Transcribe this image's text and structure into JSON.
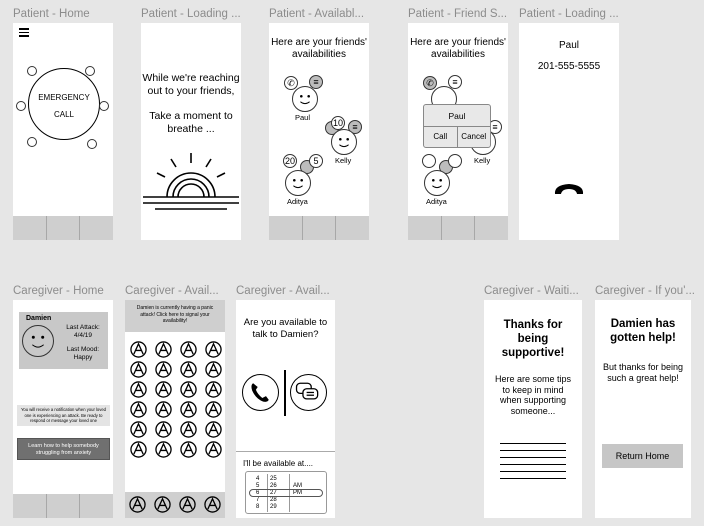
{
  "frames": {
    "f1": "Patient - Home",
    "f2": "Patient - Loading ...",
    "f3": "Patient - Availabl...",
    "f4": "Patient - Friend S...",
    "f5": "Patient - Loading ...",
    "f6": "Caregiver - Home",
    "f7": "Caregiver - Avail...",
    "f8": "Caregiver - Avail...",
    "f9": "Caregiver - Waiti...",
    "f10": "Caregiver - If you'..."
  },
  "patient_home": {
    "emergency_line1": "EMERGENCY",
    "emergency_line2": "CALL"
  },
  "patient_loading": {
    "line1": "While we're reaching",
    "line2": "out to your friends,",
    "line3": "Take a moment to",
    "line4": "breathe ..."
  },
  "availability": {
    "heading_line1": "Here are your friends'",
    "heading_line2": "availabilities",
    "friends": [
      "Paul",
      "Kelly",
      "Aditya"
    ],
    "badges": {
      "kelly": "10",
      "aditya_time": "20",
      "aditya_small": "5",
      "kelly_small": "5"
    }
  },
  "friend_select": {
    "heading_line1": "Here are your friends'",
    "heading_line2": "availabilities",
    "popup_name": "Paul",
    "call_button": "Call",
    "cancel_button": "Cancel",
    "friends": [
      "Kelly",
      "Aditya"
    ]
  },
  "calling": {
    "name": "Paul",
    "phone": "201-555-5555"
  },
  "caregiver_home": {
    "patient_name": "Damien",
    "last_attack_label": "Last Attack:",
    "last_attack_date": "4/4/19",
    "last_mood_label": "Last Mood:",
    "last_mood_value": "Happy",
    "notice": "You will receive a notification when your loved one is experiencing an attack. Be ready to respond or message your loved one",
    "help_button_line1": "Learn how to help somebody",
    "help_button_line2": "struggling from anxiety"
  },
  "caregiver_alert": {
    "banner": "Damien is currently having a panic attack! Click here to signal your availability!"
  },
  "caregiver_respond": {
    "question_line1": "Are you available to",
    "question_line2": "talk to Damien?",
    "later_label": "I'll be available at....",
    "hours": [
      "4",
      "5",
      "6",
      "7",
      "8"
    ],
    "minutes": [
      "25",
      "26",
      "27",
      "28",
      "29"
    ],
    "ampm": [
      "AM",
      "PM"
    ]
  },
  "caregiver_waiting": {
    "title_line1": "Thanks for",
    "title_line2": "being",
    "title_line3": "supportive!",
    "body_line1": "Here are some tips",
    "body_line2": "to keep in mind",
    "body_line3": "when supporting",
    "body_line4": "someone..."
  },
  "caregiver_done": {
    "title_line1": "Damien has",
    "title_line2": "gotten help!",
    "body_line1": "But thanks for being",
    "body_line2": "such a great help!",
    "return_button": "Return Home"
  }
}
